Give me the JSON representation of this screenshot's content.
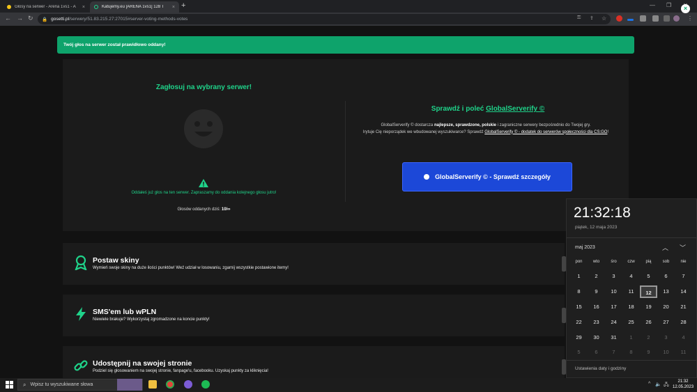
{
  "browser": {
    "tabs": [
      {
        "title": "Głosy na serwer - Arena 1vs1 - A"
      },
      {
        "title": "Katujemy.eu [ARENA 1vs1] 128 T"
      }
    ],
    "url_host": "gosetti.pl",
    "url_path": "/serwery/51.83.215.27:27015#server-voting-methods-votes"
  },
  "toast": {
    "message": "Twój głos na serwer został prawidłowo oddany!",
    "close": "×"
  },
  "vote": {
    "title": "Zagłosuj na wybrany serwer!",
    "already_voted": "Oddałeś już głos na ten serwer. Zapraszamy do oddania kolejnego głosu jutro!",
    "count_label": "Głosów oddanych dziś:",
    "count_value": "10/∞"
  },
  "globalserverify": {
    "title_prefix": "Sprawdź i poleć",
    "title_link": "GlobalServerify ©",
    "desc_1": "GlobalServerify © dostarcza",
    "desc_bold": "najlepsze, sprawdzone, polskie",
    "desc_2": "i zagraniczne serwery bezpośrednio do Twojej gry.",
    "desc_3": "Irytuje Cię nieporządek we wbudowanej wyszukiwarce? Sprawdź",
    "desc_link": "GlobalServerify © - dodatek do serwerów społeczności dla CS:GO",
    "desc_end": "!",
    "button": "GlobalServerify © - Sprawdź szczegóły"
  },
  "cards": [
    {
      "title": "Postaw skiny",
      "desc": "Wymień swoje skiny na duże ilości punktów! Weź udział w losowaniu, zgarnij wszystkie postawione itemy!",
      "icon": "award-icon"
    },
    {
      "title": "SMS'em lub wPLN",
      "desc": "Niewiele brakuje? Wykorzystaj zgromadzone na koncie punkty!",
      "icon": "lightning-icon"
    },
    {
      "title": "Udostępnij na swojej stronie",
      "desc": "Podziel się głosowaniem na swojej stronie, fanpage'u, facebooku. Uzyskaj punkty za kliknięcia!",
      "icon": "link-icon"
    }
  ],
  "clock": {
    "time": "21:32:18",
    "date": "piątek, 12 maja 2023",
    "month": "maj 2023",
    "weekdays": [
      "pon",
      "wto",
      "śro",
      "czw",
      "pią",
      "sob",
      "nie"
    ],
    "weeks": [
      [
        "1",
        "2",
        "3",
        "4",
        "5",
        "6",
        "7"
      ],
      [
        "8",
        "9",
        "10",
        "11",
        "12",
        "13",
        "14"
      ],
      [
        "15",
        "16",
        "17",
        "18",
        "19",
        "20",
        "21"
      ],
      [
        "22",
        "23",
        "24",
        "25",
        "26",
        "27",
        "28"
      ],
      [
        "29",
        "30",
        "31",
        "1",
        "2",
        "3",
        "4"
      ],
      [
        "5",
        "6",
        "7",
        "8",
        "9",
        "10",
        "11"
      ]
    ],
    "today": "12",
    "settings": "Ustawienia daty i godziny"
  },
  "taskbar": {
    "search_placeholder": "Wpisz tu wyszukiwane słowa",
    "time": "21:32",
    "date": "12.05.2023"
  },
  "colors": {
    "accent_green": "#1fd38a",
    "toast_green": "#0ea36b",
    "button_blue": "#1c48d8"
  }
}
